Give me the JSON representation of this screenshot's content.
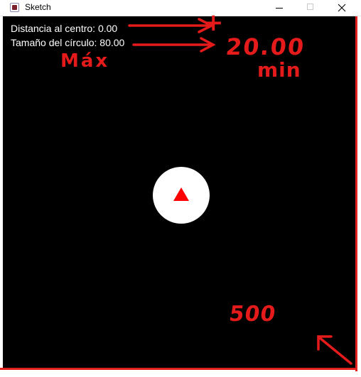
{
  "window": {
    "title": "Sketch",
    "icon": "processing-sketch-icon",
    "controls": [
      "minimize",
      "maximize",
      "close"
    ]
  },
  "canvas": {
    "background": "#000000",
    "distance_label": "Distancia al centro: 0.00",
    "size_label": "Tamaño del círculo: 80.00",
    "circle_color": "#ffffff",
    "marker_color": "#ff0000"
  },
  "annotations": {
    "color": "#e51b1b",
    "plus": "+",
    "max": "Máx",
    "twenty": "20.00",
    "min": "min",
    "five_hundred": "500"
  }
}
